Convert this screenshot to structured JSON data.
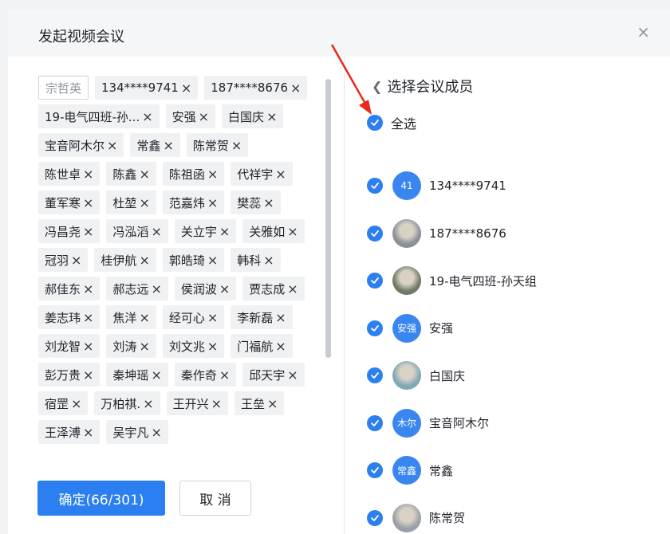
{
  "dialog": {
    "title": "发起视频会议",
    "close_glyph": "×"
  },
  "selected_chips": [
    {
      "label": "宗哲英",
      "removable": false
    },
    {
      "label": "134****9741",
      "removable": true
    },
    {
      "label": "187****8676",
      "removable": true
    },
    {
      "label": "19-电气四班-孙...",
      "removable": true
    },
    {
      "label": "安强",
      "removable": true
    },
    {
      "label": "白国庆",
      "removable": true
    },
    {
      "label": "宝音阿木尔",
      "removable": true
    },
    {
      "label": "常鑫",
      "removable": true
    },
    {
      "label": "陈常贺",
      "removable": true
    },
    {
      "label": "陈世卓",
      "removable": true
    },
    {
      "label": "陈鑫",
      "removable": true
    },
    {
      "label": "陈祖函",
      "removable": true
    },
    {
      "label": "代祥宇",
      "removable": true
    },
    {
      "label": "董军寒",
      "removable": true
    },
    {
      "label": "杜堃",
      "removable": true
    },
    {
      "label": "范嘉炜",
      "removable": true
    },
    {
      "label": "樊蕊",
      "removable": true
    },
    {
      "label": "冯昌尧",
      "removable": true
    },
    {
      "label": "冯泓滔",
      "removable": true
    },
    {
      "label": "关立宇",
      "removable": true
    },
    {
      "label": "关雅如",
      "removable": true
    },
    {
      "label": "冠羽",
      "removable": true
    },
    {
      "label": "桂伊航",
      "removable": true
    },
    {
      "label": "郭皓琦",
      "removable": true
    },
    {
      "label": "韩科",
      "removable": true
    },
    {
      "label": "郝佳东",
      "removable": true
    },
    {
      "label": "郝志远",
      "removable": true
    },
    {
      "label": "侯润波",
      "removable": true
    },
    {
      "label": "贾志成",
      "removable": true
    },
    {
      "label": "姜志玮",
      "removable": true
    },
    {
      "label": "焦洋",
      "removable": true
    },
    {
      "label": "经可心",
      "removable": true
    },
    {
      "label": "李新磊",
      "removable": true
    },
    {
      "label": "刘龙智",
      "removable": true
    },
    {
      "label": "刘涛",
      "removable": true
    },
    {
      "label": "刘文兆",
      "removable": true
    },
    {
      "label": "门福航",
      "removable": true
    },
    {
      "label": "彭万贵",
      "removable": true
    },
    {
      "label": "秦坤瑶",
      "removable": true
    },
    {
      "label": "秦作奇",
      "removable": true
    },
    {
      "label": "邱天宇",
      "removable": true
    },
    {
      "label": "宿罡",
      "removable": true
    },
    {
      "label": "万柏祺.",
      "removable": true
    },
    {
      "label": "王开兴",
      "removable": true
    },
    {
      "label": "王垒",
      "removable": true
    },
    {
      "label": "王泽溥",
      "removable": true
    },
    {
      "label": "吴宇凡",
      "removable": true
    }
  ],
  "chip_remove_glyph": "×",
  "buttons": {
    "confirm": "确定(66/301)",
    "cancel": "取 消"
  },
  "right_panel": {
    "back_label": "选择会议成员",
    "select_all_label": "全选",
    "members": [
      {
        "name": "134****9741",
        "avatar_text": "41",
        "avatar_color": "#3a86f0"
      },
      {
        "name": "187****8676",
        "avatar_text": "",
        "avatar_color": "#8a8f99"
      },
      {
        "name": "19-电气四班-孙天组",
        "avatar_text": "",
        "avatar_color": "#6f7a64"
      },
      {
        "name": "安强",
        "avatar_text": "安强",
        "avatar_color": "#3a86f0"
      },
      {
        "name": "白国庆",
        "avatar_text": "",
        "avatar_color": "#7fa8b8"
      },
      {
        "name": "宝音阿木尔",
        "avatar_text": "木尔",
        "avatar_color": "#3a86f0"
      },
      {
        "name": "常鑫",
        "avatar_text": "常鑫",
        "avatar_color": "#3a86f0"
      },
      {
        "name": "陈常贺",
        "avatar_text": "",
        "avatar_color": "#9aa0a8"
      }
    ]
  },
  "colors": {
    "accent": "#2b7ff0",
    "annotation_arrow": "#e8291c"
  }
}
